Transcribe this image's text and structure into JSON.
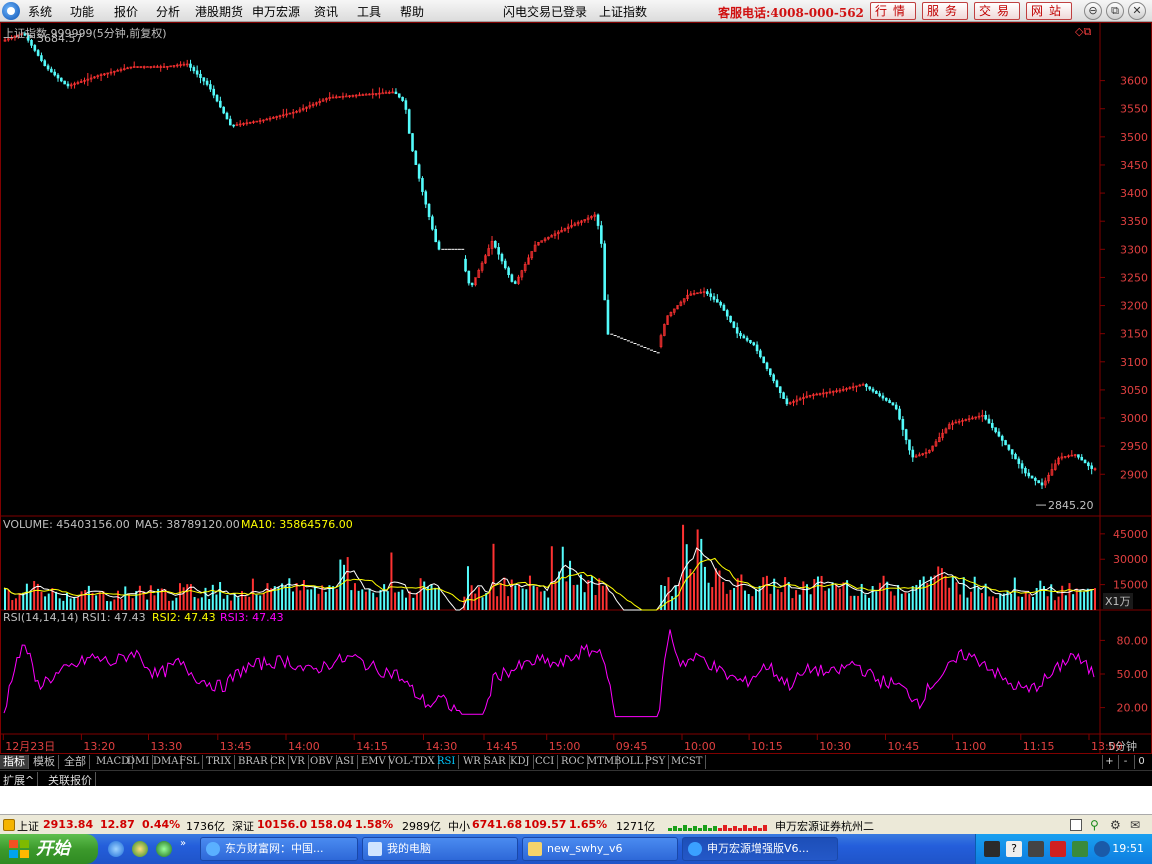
{
  "menubar": {
    "items": [
      "系统",
      "功能",
      "报价",
      "分析",
      "港股期货",
      "申万宏源",
      "资讯",
      "工具",
      "帮助"
    ],
    "center_items": [
      "闪电交易已登录",
      "上证指数"
    ],
    "hotline": "客服电话:4008-000-562",
    "nav_buttons": [
      "行情",
      "服务",
      "交易",
      "网站"
    ],
    "window_buttons": [
      "⊖",
      "⧉",
      "✕"
    ]
  },
  "chart": {
    "title": "上证指数 999999(5分钟,前复权)",
    "high_label": "3684.57",
    "low_label": "2845.20",
    "volume_title": {
      "volume": "VOLUME: 45403156.00",
      "ma5": "MA5: 38789120.00",
      "ma10": "MA10: 35864576.00"
    },
    "volume_unit": "X1万",
    "rsi_title": {
      "name": "RSI(14,14,14)",
      "rsi1": "RSI1: 47.43",
      "rsi2": "RSI2: 47.43",
      "rsi3": "RSI3: 47.43"
    },
    "period_label": "5分钟",
    "colors": {
      "up": "#ff3232",
      "down": "#54fcfc",
      "frame": "#800000",
      "ma5": "#ffffff",
      "ma10": "#ffff00",
      "rsi": "#ff00ff"
    }
  },
  "chart_data": {
    "type": "candlestick",
    "price_axis": {
      "ticks": [
        "3600",
        "3550",
        "3500",
        "3450",
        "3400",
        "3350",
        "3300",
        "3250",
        "3200",
        "3150",
        "3100",
        "3050",
        "3000",
        "2950",
        "2900"
      ],
      "range": [
        2845.2,
        3684.57
      ]
    },
    "volume_axis": {
      "ticks": [
        "45000",
        "30000",
        "15000"
      ]
    },
    "rsi_axis": {
      "ticks": [
        "80.00",
        "50.00",
        "20.00"
      ],
      "range": [
        0,
        100
      ]
    },
    "x_ticks": [
      "12月23日",
      "13:20",
      "13:30",
      "13:45",
      "14:00",
      "14:15",
      "14:30",
      "14:45",
      "15:00",
      "09:45",
      "10:00",
      "10:15",
      "10:30",
      "10:45",
      "11:00",
      "11:15",
      "13:00"
    ],
    "x_tick_positions": [
      0.003,
      0.074,
      0.135,
      0.198,
      0.26,
      0.322,
      0.385,
      0.44,
      0.497,
      0.558,
      0.62,
      0.681,
      0.743,
      0.805,
      0.866,
      0.928,
      0.99
    ],
    "price_path": [
      [
        0.0,
        3670
      ],
      [
        0.02,
        3684.57
      ],
      [
        0.04,
        3625
      ],
      [
        0.06,
        3590
      ],
      [
        0.09,
        3610
      ],
      [
        0.12,
        3625
      ],
      [
        0.15,
        3625
      ],
      [
        0.17,
        3630
      ],
      [
        0.19,
        3590
      ],
      [
        0.21,
        3520
      ],
      [
        0.24,
        3530
      ],
      [
        0.27,
        3545
      ],
      [
        0.3,
        3570
      ],
      [
        0.33,
        3575
      ],
      [
        0.36,
        3580
      ],
      [
        0.37,
        3560
      ],
      [
        0.375,
        3490
      ],
      [
        0.385,
        3410
      ],
      [
        0.4,
        3300
      ],
      [
        0.42,
        3300
      ],
      [
        0.43,
        3230
      ],
      [
        0.45,
        3315
      ],
      [
        0.47,
        3235
      ],
      [
        0.49,
        3310
      ],
      [
        0.52,
        3340
      ],
      [
        0.545,
        3362
      ],
      [
        0.55,
        3315
      ],
      [
        0.555,
        3150
      ],
      [
        0.6,
        3115
      ],
      [
        0.61,
        3180
      ],
      [
        0.63,
        3220
      ],
      [
        0.645,
        3225
      ],
      [
        0.66,
        3200
      ],
      [
        0.675,
        3150
      ],
      [
        0.69,
        3130
      ],
      [
        0.72,
        3025
      ],
      [
        0.74,
        3040
      ],
      [
        0.77,
        3050
      ],
      [
        0.79,
        3060
      ],
      [
        0.82,
        3020
      ],
      [
        0.835,
        2930
      ],
      [
        0.85,
        2940
      ],
      [
        0.87,
        2990
      ],
      [
        0.9,
        3005
      ],
      [
        0.92,
        2955
      ],
      [
        0.94,
        2900
      ],
      [
        0.955,
        2880
      ],
      [
        0.97,
        2930
      ],
      [
        0.985,
        2935
      ],
      [
        1.0,
        2910
      ]
    ],
    "rsi_path": [
      [
        0.0,
        15
      ],
      [
        0.01,
        60
      ],
      [
        0.02,
        77
      ],
      [
        0.03,
        40
      ],
      [
        0.05,
        50
      ],
      [
        0.08,
        65
      ],
      [
        0.1,
        60
      ],
      [
        0.12,
        70
      ],
      [
        0.14,
        48
      ],
      [
        0.16,
        60
      ],
      [
        0.18,
        45
      ],
      [
        0.2,
        38
      ],
      [
        0.22,
        55
      ],
      [
        0.24,
        60
      ],
      [
        0.26,
        62
      ],
      [
        0.28,
        52
      ],
      [
        0.3,
        60
      ],
      [
        0.32,
        65
      ],
      [
        0.34,
        55
      ],
      [
        0.36,
        50
      ],
      [
        0.38,
        30
      ],
      [
        0.39,
        22
      ],
      [
        0.4,
        28
      ],
      [
        0.42,
        14
      ],
      [
        0.44,
        14
      ],
      [
        0.45,
        48
      ],
      [
        0.47,
        55
      ],
      [
        0.49,
        62
      ],
      [
        0.51,
        58
      ],
      [
        0.53,
        70
      ],
      [
        0.55,
        70
      ],
      [
        0.56,
        12
      ],
      [
        0.6,
        12
      ],
      [
        0.61,
        90
      ],
      [
        0.62,
        60
      ],
      [
        0.64,
        65
      ],
      [
        0.66,
        50
      ],
      [
        0.68,
        42
      ],
      [
        0.7,
        58
      ],
      [
        0.72,
        40
      ],
      [
        0.74,
        55
      ],
      [
        0.76,
        50
      ],
      [
        0.78,
        60
      ],
      [
        0.8,
        45
      ],
      [
        0.82,
        40
      ],
      [
        0.84,
        25
      ],
      [
        0.85,
        40
      ],
      [
        0.87,
        58
      ],
      [
        0.88,
        68
      ],
      [
        0.9,
        60
      ],
      [
        0.92,
        42
      ],
      [
        0.94,
        35
      ],
      [
        0.96,
        48
      ],
      [
        0.98,
        68
      ],
      [
        1.0,
        50
      ]
    ],
    "volume_level": [
      0.18,
      0.25,
      0.2,
      0.22,
      0.18,
      0.2,
      0.23,
      0.2,
      0.22,
      0.24,
      0.2,
      0.26,
      0.22,
      0.3,
      0.25,
      0.45,
      0.28,
      0.24,
      0.22,
      0.3,
      0.22,
      0.25,
      0.3,
      0.26,
      0.28,
      0.6,
      0.3,
      0.28,
      0.25,
      0.35,
      0.3,
      0.8,
      0.35,
      0.3,
      0.28,
      0.3,
      0.27,
      0.29,
      0.3,
      0.26,
      0.28,
      0.3,
      0.4,
      0.32,
      0.28,
      0.25,
      0.28,
      0.24,
      0.22,
      0.2
    ]
  },
  "tabs": [
    "指标",
    "模板",
    "全部",
    "MACD",
    "DMI",
    "DMA",
    "FSL",
    "TRIX",
    "BRAR",
    "CR",
    "VR",
    "OBV",
    "ASI",
    "EMV",
    "VOL-TDX",
    "RSI",
    "WR",
    "SAR",
    "KDJ",
    "CCI",
    "ROC",
    "MTM",
    "BOLL",
    "PSY",
    "MCST"
  ],
  "tab_controls": [
    "+",
    "-",
    "0"
  ],
  "ext_tabs": [
    "扩展^",
    "关联报价"
  ],
  "statusbar": {
    "sh": {
      "label": "上证",
      "value": "2913.84",
      "change": "12.87",
      "pct": "0.44%",
      "amount": "1736亿"
    },
    "sz": {
      "label": "深证",
      "value": "10156.0",
      "change": "158.04",
      "pct": "1.58%",
      "amount": "2989亿"
    },
    "zx": {
      "label": "中小",
      "value": "6741.68",
      "change": "109.57",
      "pct": "1.65%",
      "amount": "1271亿"
    },
    "broker": "申万宏源证券杭州二"
  },
  "taskbar": {
    "start": "开始",
    "tasks": [
      "东方财富网：中国...",
      "我的电脑",
      "new_swhy_v6",
      "申万宏源增强版V6..."
    ],
    "clock": "19:51"
  }
}
